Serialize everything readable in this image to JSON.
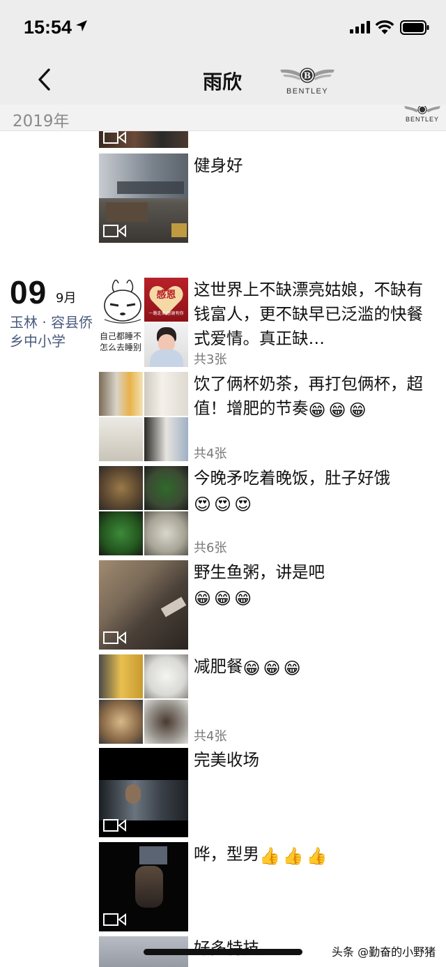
{
  "status_bar": {
    "time": "15:54"
  },
  "nav": {
    "title": "雨欣",
    "logo_text": "BENTLEY"
  },
  "year_header": {
    "year": "2019年",
    "logo_text": "BENTLEY"
  },
  "date_group": {
    "day": "09",
    "month": "9月",
    "location": "玉林 · 容县侨乡中小学"
  },
  "posts": [
    {
      "text": "健身好"
    },
    {
      "text": "这世界上不缺漂亮姑娘，不缺有钱富人，更不缺早已泛滥的快餐式爱情。真正缺…",
      "count": "共3张",
      "thumb_caption": "自己都睡不怎么去睡别",
      "card_title": "感恩",
      "card_sub": "一路走来 感谢有你"
    },
    {
      "text": "饮了俩杯奶茶，再打包俩杯，超值！增肥的节奏",
      "emoji": [
        "😁",
        "😁",
        "😁"
      ],
      "count": "共4张"
    },
    {
      "text": "今晚矛吃着晚饭，肚子好饿",
      "emoji": [
        "😍",
        "😍",
        "😍"
      ],
      "count": "共6张"
    },
    {
      "text": "野生鱼粥，讲是吧",
      "emoji": [
        "😁",
        "😁",
        "😁"
      ]
    },
    {
      "text": "减肥餐",
      "emoji": [
        "😁",
        "😁",
        "😁"
      ],
      "count": "共4张"
    },
    {
      "text": "完美收场"
    },
    {
      "text": "哗，型男",
      "emoji": [
        "👍",
        "👍",
        "👍"
      ]
    },
    {
      "text": "好多特技"
    }
  ],
  "watermark": "头条 @勤奋的小野猪",
  "colors": {
    "bar_bg": "#ededed",
    "location_link": "#4a5b7d",
    "count_gray": "#777777"
  }
}
